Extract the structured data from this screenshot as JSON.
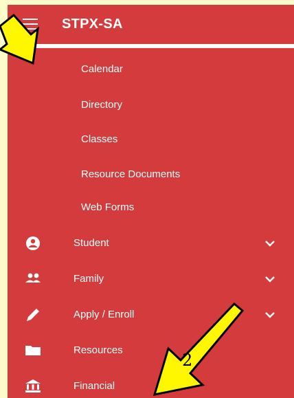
{
  "header": {
    "title": "STPX-SA"
  },
  "submenu": {
    "items": [
      "Calendar",
      "Directory",
      "Classes",
      "Resource Documents",
      "Web Forms"
    ]
  },
  "nav": {
    "items": [
      {
        "label": "Student",
        "icon": "student-icon",
        "has_chevron": true
      },
      {
        "label": "Family",
        "icon": "family-icon",
        "has_chevron": true
      },
      {
        "label": "Apply / Enroll",
        "icon": "pencil-icon",
        "has_chevron": true
      },
      {
        "label": "Resources",
        "icon": "folder-icon",
        "has_chevron": false
      },
      {
        "label": "Financial",
        "icon": "bank-icon",
        "has_chevron": false
      }
    ]
  },
  "annotation": {
    "step_number": "2"
  },
  "colors": {
    "panel_bg": "#d33b3c",
    "page_bg": "#fdfbc9",
    "arrow_fill": "#fff700",
    "text": "#ffffff"
  }
}
